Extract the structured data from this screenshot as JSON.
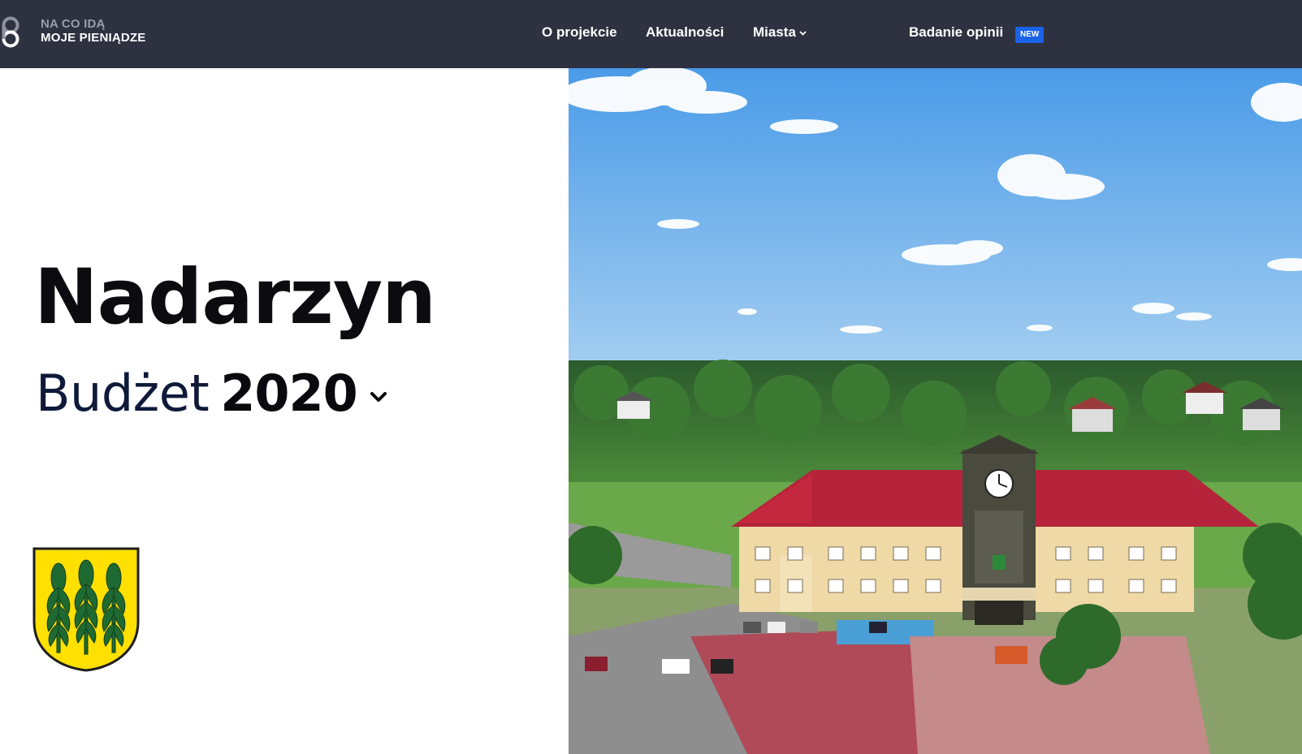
{
  "brand": {
    "line1": "NA CO IDĄ",
    "line2": "MOJE PIENIĄDZE",
    "icon": "logo-icon"
  },
  "nav": {
    "items": [
      {
        "label": "O projekcie"
      },
      {
        "label": "Aktualności"
      },
      {
        "label": "Miasta",
        "icon": "chevron-down-icon"
      },
      {
        "label": "Badanie opinii",
        "badge": "NEW"
      }
    ]
  },
  "hero": {
    "city": "Nadarzyn",
    "budget_label": "Budżet",
    "year": "2020",
    "year_icon": "chevron-down-icon",
    "coat_of_arms_icon": "coat-of-arms-icon",
    "photo": "town-hall-aerial-photo"
  },
  "colors": {
    "nav_bg": "#2e3140",
    "badge_bg": "#1a62e8",
    "coat_yellow": "#ffe000",
    "coat_green": "#1f6a32",
    "roof_red": "#b5243a"
  }
}
